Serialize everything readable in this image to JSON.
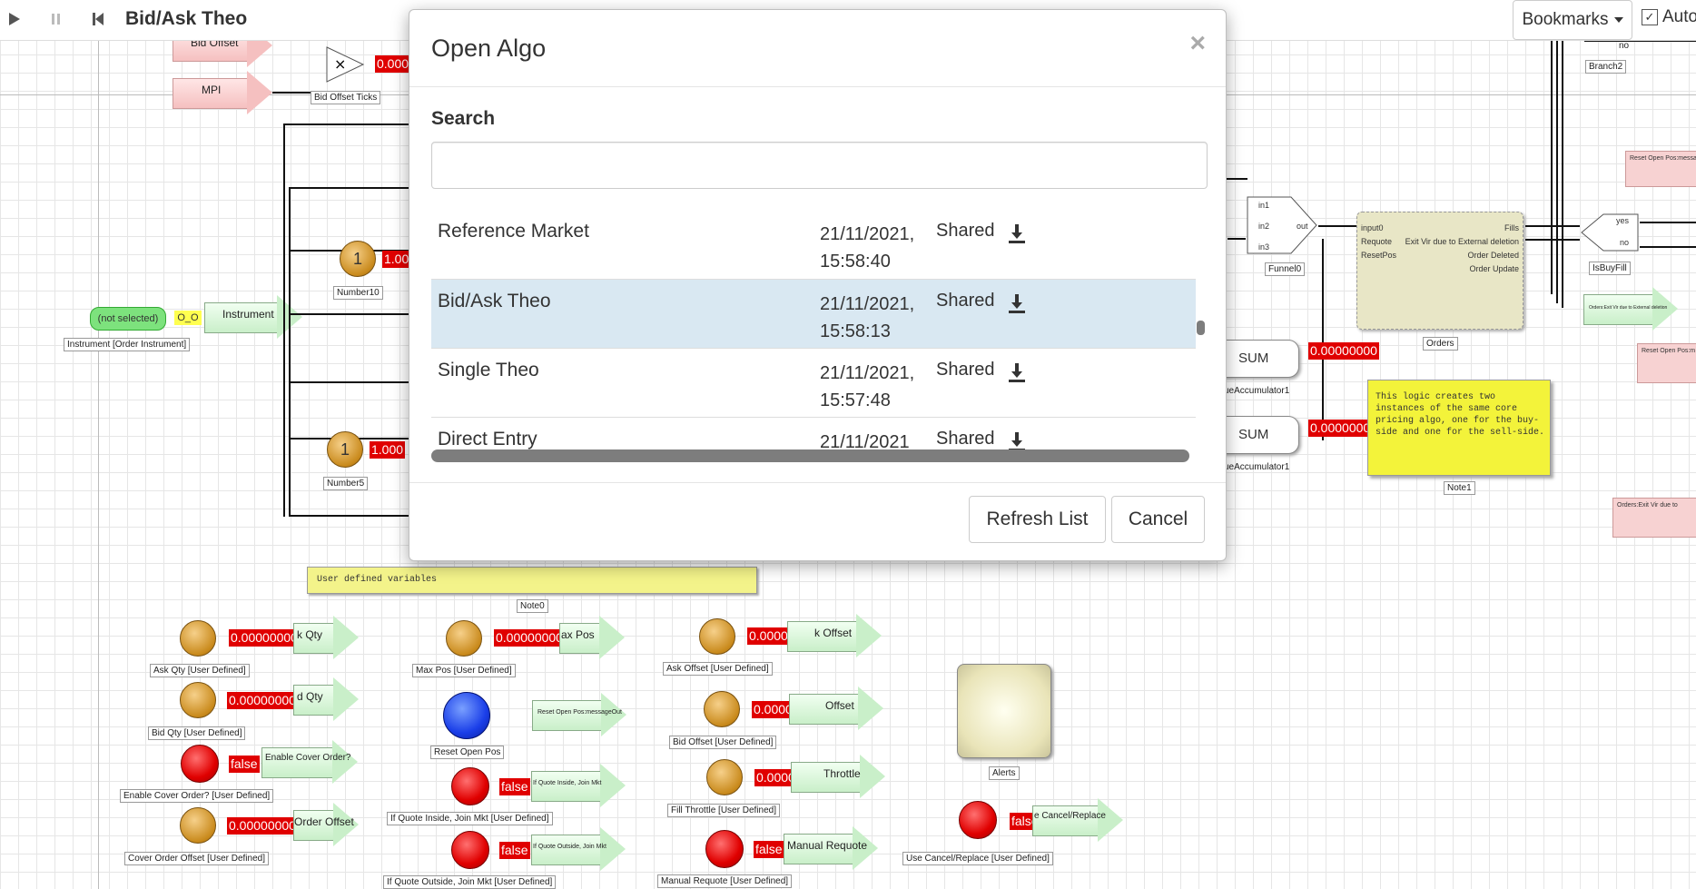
{
  "toolbar": {
    "title": "Bid/Ask Theo",
    "bookmarks_label": "Bookmarks",
    "auto_label": "Auto"
  },
  "canvas": {
    "top_nodes": {
      "bid_offset": "Bid Offset",
      "mpi": "MPI",
      "mult_symbol": "×",
      "bid_offset_ticks": "Bid Offset Ticks",
      "mult_value": "0.000",
      "number10_value": "1",
      "number10_out": "1.00",
      "number10_cap": "Number10",
      "number5_value": "1",
      "number5_out": "1.000",
      "number5_cap": "Number5",
      "not_selected": "(not selected)",
      "o_o": "O_O",
      "instrument": "Instrument",
      "instrument_cap": "Instrument [Order Instrument]"
    },
    "right_nodes": {
      "branch2_no": "no",
      "branch2_cap": "Branch2",
      "funnel_in1": "in1",
      "funnel_in2": "in2",
      "funnel_in3": "in3",
      "funnel_out": "out",
      "funnel_cap": "Funnel0",
      "orders_input": "input0",
      "orders_requote": "Requote",
      "orders_resetpos": "ResetPos",
      "orders_fills": "Fills",
      "orders_exit": "Exit Vir due to External deletion",
      "orders_deleted": "Order Deleted",
      "orders_update": "Order Update",
      "orders_cap": "Orders",
      "isbuyfill_yes": "yes",
      "isbuyfill_no": "no",
      "isbuyfill_cap": "IsBuyFill",
      "sum1": "SUM",
      "sum1_val": "0.00000000",
      "sum1_cap": "ueAccumulator1",
      "sum2": "SUM",
      "sum2_val": "0.00000000",
      "sum2_cap": "ueAccumulator1",
      "note1_text": "This logic creates two instances of the same core pricing algo, one for the buy-side and one for the sell-side.",
      "note1_cap": "Note1",
      "pink1": "Reset Open Pos:message",
      "pink2": "Reset Open Pos:m",
      "pink3": "Orders:Exit Vir due to",
      "green_exit": "Orders:Exit Vir due to External deletion"
    },
    "note0_text": "User defined variables",
    "note0_cap": "Note0",
    "vars": {
      "ask_qty_val": "0.00000000",
      "ask_qty_lbl": "k Qty",
      "ask_qty_cap": "Ask Qty [User Defined]",
      "bid_qty_val": "0.00000000",
      "bid_qty_lbl": "d Qty",
      "bid_qty_cap": "Bid Qty [User Defined]",
      "enable_cover_val": "false",
      "enable_cover_lbl": "Enable Cover Order?",
      "enable_cover_cap": "Enable Cover Order?  [User Defined]",
      "cover_offset_val": "0.00000000",
      "cover_offset_lbl": "Order Offset",
      "cover_offset_cap": "Cover Order Offset [User Defined]",
      "max_pos_val": "0.00000000",
      "max_pos_lbl": "ax Pos",
      "max_pos_cap": "Max Pos [User Defined]",
      "reset_open_lbl": "Reset Open Pos:messageOut",
      "reset_open_cap": "Reset Open Pos",
      "quote_inside_val": "false",
      "quote_inside_lbl": "If Quote Inside, Join Mkt",
      "quote_inside_cap": "If Quote Inside, Join Mkt [User Defined]",
      "quote_outside_val": "false",
      "quote_outside_lbl": "If Quote Outside, Join Mkt",
      "quote_outside_cap": "If Quote Outside, Join Mkt [User Defined]",
      "ask_offset_val": "0.00000000",
      "ask_offset_lbl": "k Offset",
      "ask_offset_cap": "Ask Offset [User Defined]",
      "bid_offset_val": "0.00000000",
      "bid_offset_lbl": "Offset",
      "bid_offset_cap": "Bid Offset [User Defined]",
      "fill_throttle_val": "0.00000000",
      "fill_throttle_lbl": "Throttle",
      "fill_throttle_cap": "Fill Throttle [User Defined]",
      "manual_requote_val": "false",
      "manual_requote_lbl": "Manual Requote",
      "manual_requote_cap": "Manual Requote [User Defined]",
      "alerts_cap": "Alerts",
      "cancel_replace_val": "false",
      "cancel_replace_lbl": "e Cancel/Replace",
      "cancel_replace_cap": "Use Cancel/Replace [User Defined]"
    }
  },
  "modal": {
    "title": "Open Algo",
    "close": "×",
    "search_label": "Search",
    "search_value": "",
    "rows": [
      {
        "name": "Reference Market",
        "date": "21/11/2021,",
        "time": "15:58:40",
        "shared": "Shared"
      },
      {
        "name": "Bid/Ask Theo",
        "date": "21/11/2021,",
        "time": "15:58:13",
        "shared": "Shared"
      },
      {
        "name": "Single Theo",
        "date": "21/11/2021,",
        "time": "15:57:48",
        "shared": "Shared"
      },
      {
        "name": "Direct Entry",
        "date": "21/11/2021",
        "time": "",
        "shared": "Shared"
      }
    ],
    "refresh_label": "Refresh List",
    "cancel_label": "Cancel"
  },
  "colors": {
    "selected_row": "#d9e8f2",
    "value_red": "#e00000",
    "node_green": "#c9efc9",
    "node_pink": "#f5c0c0",
    "note_yellow": "#f3f33a"
  }
}
